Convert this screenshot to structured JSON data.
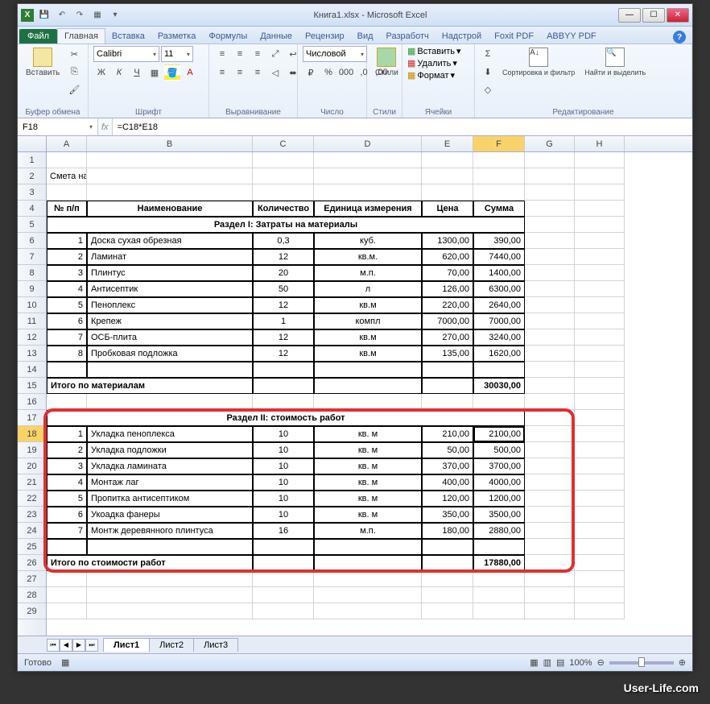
{
  "title": "Книга1.xlsx - Microsoft Excel",
  "ribbon": {
    "file": "Файл",
    "tabs": [
      "Главная",
      "Вставка",
      "Разметка",
      "Формулы",
      "Данные",
      "Рецензир",
      "Вид",
      "Разработч",
      "Надстрой",
      "Foxit PDF",
      "ABBYY PDF"
    ],
    "active": 0,
    "groups": {
      "clipboard": "Буфер обмена",
      "font": "Шрифт",
      "alignment": "Выравнивание",
      "number": "Число",
      "styles": "Стили",
      "cells": "Ячейки",
      "editing": "Редактирование"
    },
    "paste": "Вставить",
    "font_name": "Calibri",
    "font_size": "11",
    "number_format": "Числовой",
    "insert": "Вставить",
    "delete": "Удалить",
    "format": "Формат",
    "sort": "Сортировка и фильтр",
    "find": "Найти и выделить",
    "styles_btn": "Стили"
  },
  "formula_bar": {
    "name": "F18",
    "formula": "=C18*E18"
  },
  "columns": [
    "A",
    "B",
    "C",
    "D",
    "E",
    "F",
    "G",
    "H"
  ],
  "sheet": {
    "title_row": "Смета на работы",
    "headers": {
      "num": "№ п/п",
      "name": "Наименование",
      "qty": "Количество",
      "unit": "Единица измерения",
      "price": "Цена",
      "sum": "Сумма"
    },
    "section1": "Раздел I: Затраты на материалы",
    "items1": [
      {
        "n": "1",
        "name": "Доска сухая обрезная",
        "qty": "0,3",
        "unit": "куб.",
        "price": "1300,00",
        "sum": "390,00"
      },
      {
        "n": "2",
        "name": "Ламинат",
        "qty": "12",
        "unit": "кв.м.",
        "price": "620,00",
        "sum": "7440,00"
      },
      {
        "n": "3",
        "name": "Плинтус",
        "qty": "20",
        "unit": "м.п.",
        "price": "70,00",
        "sum": "1400,00"
      },
      {
        "n": "4",
        "name": "Антисептик",
        "qty": "50",
        "unit": "л",
        "price": "126,00",
        "sum": "6300,00"
      },
      {
        "n": "5",
        "name": "Пеноплекс",
        "qty": "12",
        "unit": "кв.м",
        "price": "220,00",
        "sum": "2640,00"
      },
      {
        "n": "6",
        "name": "Крепеж",
        "qty": "1",
        "unit": "компл",
        "price": "7000,00",
        "sum": "7000,00"
      },
      {
        "n": "7",
        "name": "ОСБ-плита",
        "qty": "12",
        "unit": "кв.м",
        "price": "270,00",
        "sum": "3240,00"
      },
      {
        "n": "8",
        "name": "Пробковая подложка",
        "qty": "12",
        "unit": "кв.м",
        "price": "135,00",
        "sum": "1620,00"
      }
    ],
    "total1_label": "Итого по материалам",
    "total1": "30030,00",
    "section2": "Раздел II: стоимость работ",
    "items2": [
      {
        "n": "1",
        "name": "Укладка пеноплекса",
        "qty": "10",
        "unit": "кв. м",
        "price": "210,00",
        "sum": "2100,00"
      },
      {
        "n": "2",
        "name": "Укладка подложки",
        "qty": "10",
        "unit": "кв. м",
        "price": "50,00",
        "sum": "500,00"
      },
      {
        "n": "3",
        "name": "Укладка  ламината",
        "qty": "10",
        "unit": "кв. м",
        "price": "370,00",
        "sum": "3700,00"
      },
      {
        "n": "4",
        "name": "Монтаж лаг",
        "qty": "10",
        "unit": "кв. м",
        "price": "400,00",
        "sum": "4000,00"
      },
      {
        "n": "5",
        "name": "Пропитка антисептиком",
        "qty": "10",
        "unit": "кв. м",
        "price": "120,00",
        "sum": "1200,00"
      },
      {
        "n": "6",
        "name": "Укоадка фанеры",
        "qty": "10",
        "unit": "кв. м",
        "price": "350,00",
        "sum": "3500,00"
      },
      {
        "n": "7",
        "name": "Монтж деревянного плинтуса",
        "qty": "16",
        "unit": "м.п.",
        "price": "180,00",
        "sum": "2880,00"
      }
    ],
    "total2_label": "Итого по стоимости работ",
    "total2": "17880,00"
  },
  "sheets": [
    "Лист1",
    "Лист2",
    "Лист3"
  ],
  "status": "Готово",
  "zoom": "100%",
  "watermark": "User-Life.com"
}
